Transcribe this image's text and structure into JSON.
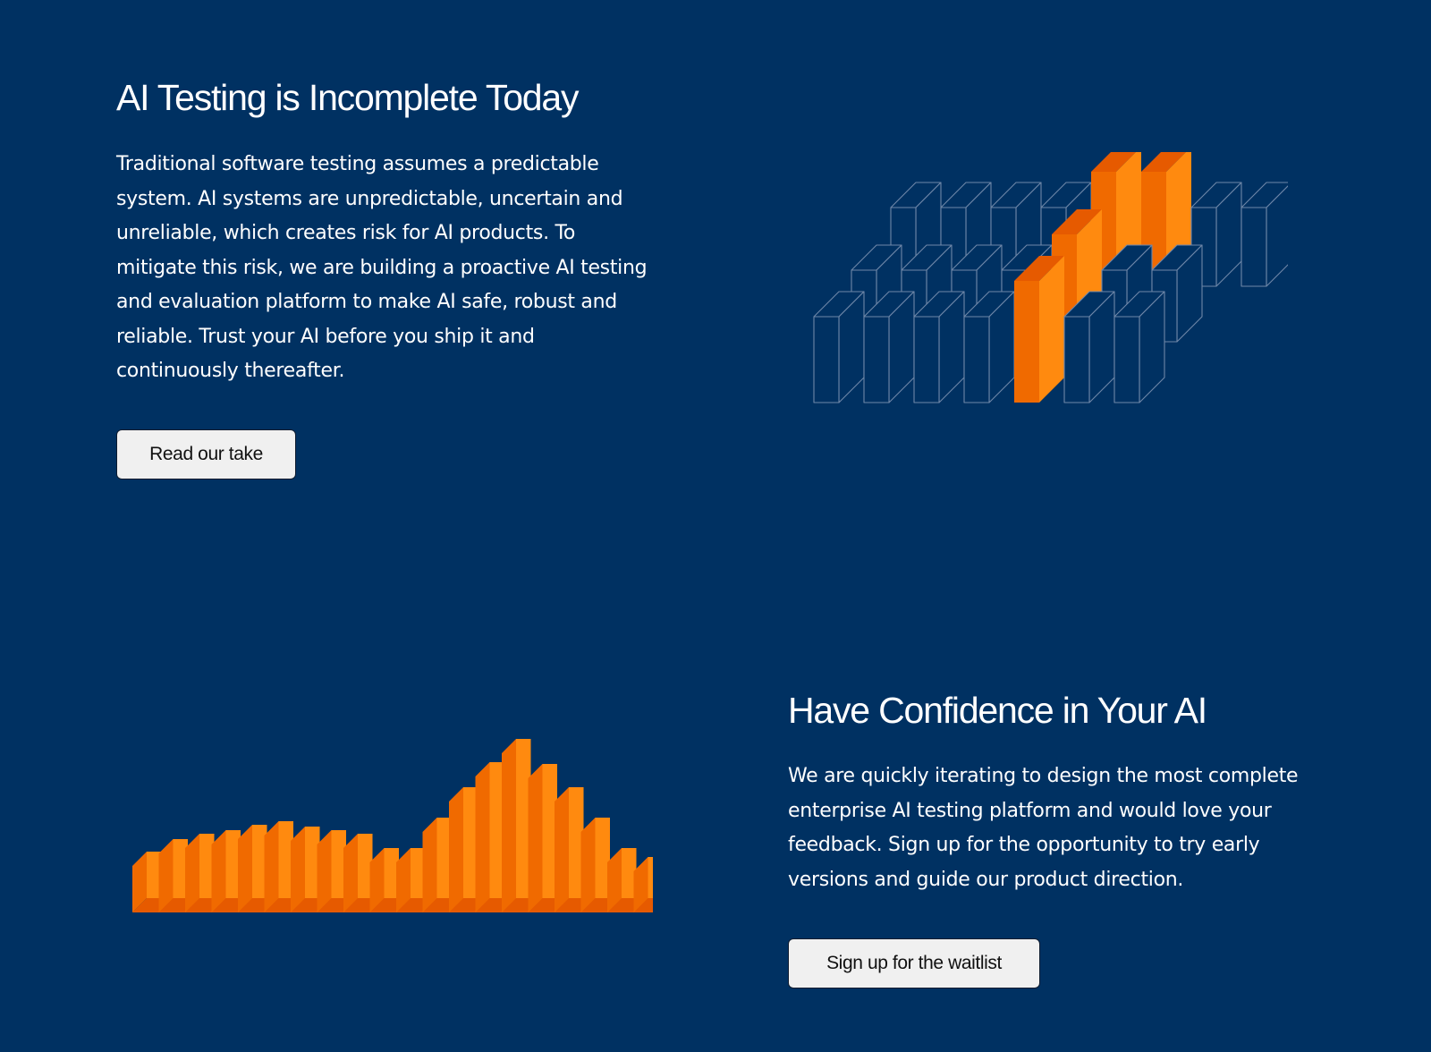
{
  "section_one": {
    "heading": "AI Testing is Incomplete Today",
    "body": "Traditional software testing assumes a predictable system. AI systems are unpredictable, uncertain and unreliable, which creates risk for AI products. To mitigate this risk, we are building a proactive AI testing and evaluation platform to make AI safe, robust and reliable. Trust your AI before you ship it and continuously thereafter.",
    "button_label": "Read our take"
  },
  "section_two": {
    "heading": "Have Confidence in Your AI",
    "body": "We are quickly iterating to design the most complete enterprise AI testing platform and would love your feedback. Sign up for the opportunity to try early versions and guide our product direction.",
    "button_label": "Sign up for the waitlist"
  },
  "colors": {
    "background": "#003162",
    "accent_orange": "#ff8a0f",
    "accent_orange_dark": "#f06a00",
    "accent_orange_top": "#e65a00",
    "outline": "#6f87a8",
    "button_bg": "#f0f0f0"
  },
  "illustrations": {
    "isometric_grid": "isometric-box-grid-illustration",
    "bar_wave": "orange-3d-bar-wave-illustration"
  }
}
